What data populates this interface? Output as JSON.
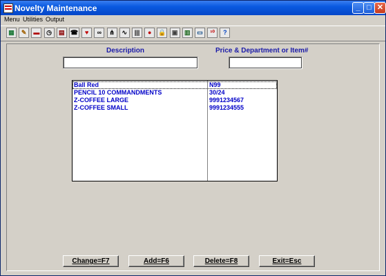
{
  "window": {
    "title": "Novelty Maintenance",
    "buttons": {
      "minimize": "_",
      "maximize": "□",
      "close": "✕"
    }
  },
  "menu": [
    "Menu",
    "Utilities",
    "Output"
  ],
  "toolbar": {
    "icons": [
      {
        "name": "calculator-icon",
        "glyph": "▦",
        "color": "#1f7a3a"
      },
      {
        "name": "notes-icon",
        "glyph": "✎",
        "color": "#a06000"
      },
      {
        "name": "print-icon",
        "glyph": "▬",
        "color": "#b00000"
      },
      {
        "name": "clock-icon",
        "glyph": "◷",
        "color": "#000000"
      },
      {
        "name": "grid-icon",
        "glyph": "▤",
        "color": "#8a0000"
      },
      {
        "name": "phone-icon",
        "glyph": "☎",
        "color": "#000000"
      },
      {
        "name": "heart-icon",
        "glyph": "♥",
        "color": "#c00000"
      },
      {
        "name": "binoculars-icon",
        "glyph": "∞",
        "color": "#000000"
      },
      {
        "name": "network-icon",
        "glyph": "⋔",
        "color": "#000000"
      },
      {
        "name": "chart-icon",
        "glyph": "∿",
        "color": "#000000"
      },
      {
        "name": "barcode-icon",
        "glyph": "|||",
        "color": "#000000"
      },
      {
        "name": "stop-icon",
        "glyph": "●",
        "color": "#c00000"
      },
      {
        "name": "lock-icon",
        "glyph": "🔒",
        "color": "#c09000"
      },
      {
        "name": "folder-icon",
        "glyph": "▣",
        "color": "#404040"
      },
      {
        "name": "bar-chart-icon",
        "glyph": "▥",
        "color": "#1f6a1f"
      },
      {
        "name": "monitor-icon",
        "glyph": "▭",
        "color": "#004080"
      },
      {
        "name": "calendar-icon",
        "glyph": "¹⁰",
        "color": "#c00000"
      },
      {
        "name": "help-icon",
        "glyph": "?",
        "color": "#0040c0"
      }
    ]
  },
  "form": {
    "description_label": "Description",
    "price_label": "Price & Department or Item#",
    "description_value": "",
    "price_value": ""
  },
  "list": {
    "rows": [
      {
        "description": "Ball Red",
        "code": "N99"
      },
      {
        "description": "PENCIL 10 COMMANDMENTS",
        "code": "30/24"
      },
      {
        "description": "Z-COFFEE  LARGE",
        "code": "9991234567"
      },
      {
        "description": "Z-COFFEE SMALL",
        "code": "9991234555"
      }
    ]
  },
  "buttons": {
    "change": "Change=F7",
    "add": "Add=F6",
    "delete": "Delete=F8",
    "exit": "Exit=Esc"
  }
}
